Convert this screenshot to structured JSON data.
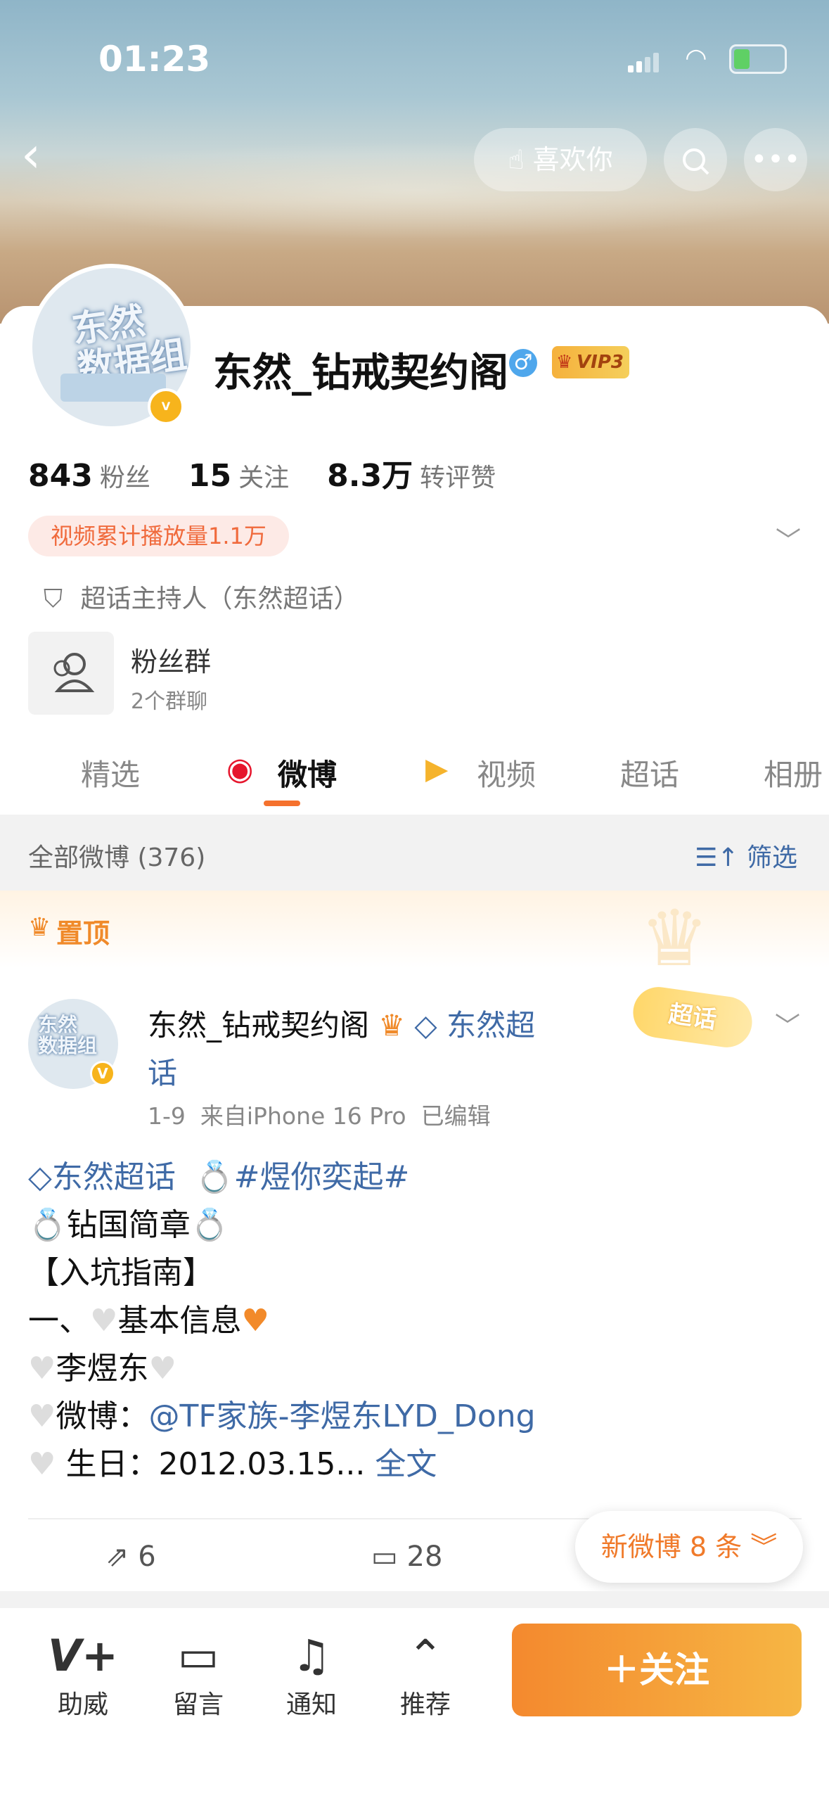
{
  "status_bar": {
    "time": "01:23"
  },
  "header": {
    "like_label": "喜欢你"
  },
  "profile": {
    "avatar_text_line1": "东然",
    "avatar_text_line2": "数据组",
    "name": "东然_钻戒契约阁",
    "vip_label": "VIP3",
    "stats": [
      {
        "value": "843",
        "label": "粉丝"
      },
      {
        "value": "15",
        "label": "关注"
      },
      {
        "value": "8.3万",
        "label": "转评赞"
      }
    ],
    "video_tag": "视频累计播放量1.1万",
    "host_text": "超话主持人（东然超话）",
    "fan_group_title": "粉丝群",
    "fan_group_sub": "2个群聊"
  },
  "tabs": [
    {
      "label": "精选",
      "active": false
    },
    {
      "label": "微博",
      "active": true
    },
    {
      "label": "视频",
      "active": false
    },
    {
      "label": "超话",
      "active": false
    },
    {
      "label": "相册",
      "active": false
    }
  ],
  "feed_header": {
    "label": "全部微博 (376)",
    "filter_label": "筛选"
  },
  "pinned_label": "置顶",
  "post": {
    "author": "东然_钻戒契约阁",
    "topic": "东然超",
    "topic_cont": "话",
    "time": "1-9",
    "source": "来自iPhone 16 Pro",
    "edited": "已编辑",
    "chaohua_tag": "超话",
    "line1_topic": "东然超话",
    "line1_hashtag": "#煜你奕起#",
    "line2": "钻国简章",
    "line3": "【入坑指南】",
    "line4_prefix": "一、",
    "line4": "基本信息",
    "line5": "李煜东",
    "line6_prefix": "微博：",
    "line6_link": "@TF家族-李煜东LYD_Dong",
    "line7": "生日：2012.03.15...",
    "line7_more": "全文",
    "reposts": "6",
    "comments": "28"
  },
  "new_posts": "新微博 8 条",
  "bottom_bar": {
    "items": [
      {
        "label": "助威",
        "icon": "cheer-icon"
      },
      {
        "label": "留言",
        "icon": "message-icon"
      },
      {
        "label": "通知",
        "icon": "bell-icon"
      },
      {
        "label": "推荐",
        "icon": "recommend-icon"
      }
    ],
    "follow_label": "关注"
  }
}
